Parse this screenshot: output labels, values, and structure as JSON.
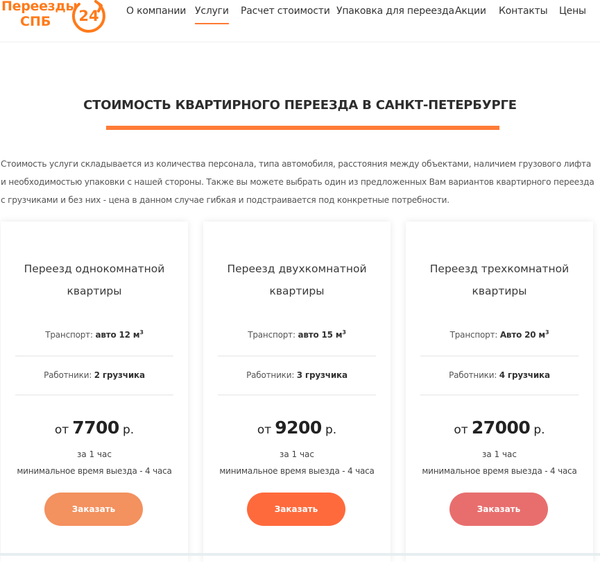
{
  "header": {
    "logo": {
      "line1": "Переезды",
      "line2": "СПБ",
      "number": "24"
    },
    "nav": [
      {
        "label": "О компании"
      },
      {
        "label": "Услуги",
        "active": true
      },
      {
        "label": "Расчет стоимости"
      },
      {
        "label": "Упаковка для переезда"
      },
      {
        "label": "Акции"
      },
      {
        "label": "Контакты"
      },
      {
        "label": "Цены"
      }
    ]
  },
  "section": {
    "title": "СТОИМОСТЬ КВАРТИРНОГО ПЕРЕЕЗДА В САНКТ-ПЕТЕРБУРГЕ",
    "intro": "Стоимость услуги складывается из количества персонала, типа автомобиля, расстояния между объектами, наличием грузового лифта и необходимостью упаковки с нашей стороны. Также вы можете выбрать один из предложенных Вам вариантов квартирного переезда с грузчиками и без них - цена в данном случае гибкая и подстраивается под конкретные потребности."
  },
  "labels": {
    "transport": "Транспорт:",
    "workers": "Работники:",
    "unit_sup": "3",
    "price_prefix": "от",
    "price_suffix": "р.",
    "per": "за 1 час",
    "minimum": "минимальное время выезда - 4 часа",
    "order": "Заказать"
  },
  "cards": [
    {
      "title_line1": "Переезд однокомнатной",
      "title_line2": "квартиры",
      "transport": "авто 12 м",
      "workers": "2 грузчика",
      "price": "7700",
      "button_bg": "#f3915f",
      "button_text_color": "#ffffff"
    },
    {
      "title_line1": "Переезд двухкомнатной",
      "title_line2": "квартиры",
      "transport": "авто 15 м",
      "workers": "3 грузчика",
      "price": "9200",
      "button_bg": "#ff6a3c",
      "button_text_color": "#ffffff"
    },
    {
      "title_line1": "Переезд трехкомнатной",
      "title_line2": "квартиры",
      "transport": "Авто 20 м",
      "workers": "4 грузчика",
      "price": "27000",
      "button_bg": "#e86e6e",
      "button_text_color": "#ffffff"
    }
  ],
  "colors": {
    "accent": "#ff7a33",
    "text": "#333333"
  }
}
